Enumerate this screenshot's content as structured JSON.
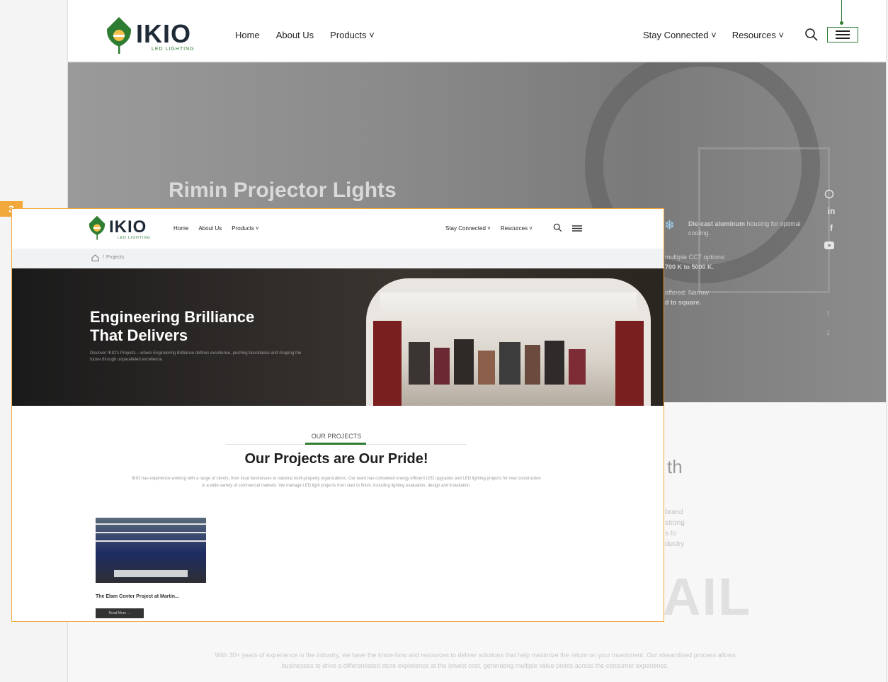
{
  "brand": {
    "name": "IKIO",
    "tagline": "LED LIGHTING",
    "green": "#2e7d32",
    "accent": "#f2a93b"
  },
  "background_page": {
    "nav": {
      "left": [
        "Home",
        "About Us",
        "Products ˅"
      ],
      "right": [
        "Stay Connected ˅",
        "Resources ˅"
      ]
    },
    "hero": {
      "title": "Rimin Projector Lights",
      "features": [
        {
          "bold": "Die-cast aluminum",
          "text": "housing for optimal cooling."
        },
        {
          "text": "multiple CCT options:",
          "bold": "700 K to 5000 K."
        },
        {
          "text": "offered: Narrow",
          "bold": "d to square."
        }
      ]
    },
    "social": [
      "in",
      "f"
    ],
    "lower": {
      "heading_fragment": "th",
      "big_text": "AIL",
      "side_fragments": [
        "brand",
        "strong",
        "s to",
        "dustry"
      ],
      "paragraph": "With 30+ years of experience in the industry, we have the know-how and resources to deliver solutions that help maximize the return on your investment. Our streamlined process allows businesses to drive a differentiated store experience at the lowest cost, generating multiple value points across the consumer experience."
    }
  },
  "overlay": {
    "badge": "3",
    "nav": {
      "left": [
        "Home",
        "About Us",
        "Products ˅"
      ],
      "right": [
        "Stay Connected ˅",
        "Resources ˅"
      ]
    },
    "breadcrumb": {
      "separator": "/",
      "current": "Projects"
    },
    "hero": {
      "title_line1": "Engineering Brilliance",
      "title_line2": "That Delivers",
      "description": "Discover IKIO's Projects – where Engineering Brilliance defines excellence, pushing boundaries and shaping the future through unparalleled excellence."
    },
    "section": {
      "eyebrow": "OUR PROJECTS",
      "heading": "Our Projects are Our Pride!",
      "body": "IKIO has experience working with a range of clients, from local businesses to national multi-property organizations. Our team has completed energy efficient LED upgrades and LED lighting projects for new construction in a wide variety of commercial markets. We manage LED light projects from start to finish, including lighting evaluation, design and installation."
    },
    "cards": [
      {
        "title": "The Elam Center Project at Martin...",
        "button": "Read More →"
      }
    ]
  }
}
